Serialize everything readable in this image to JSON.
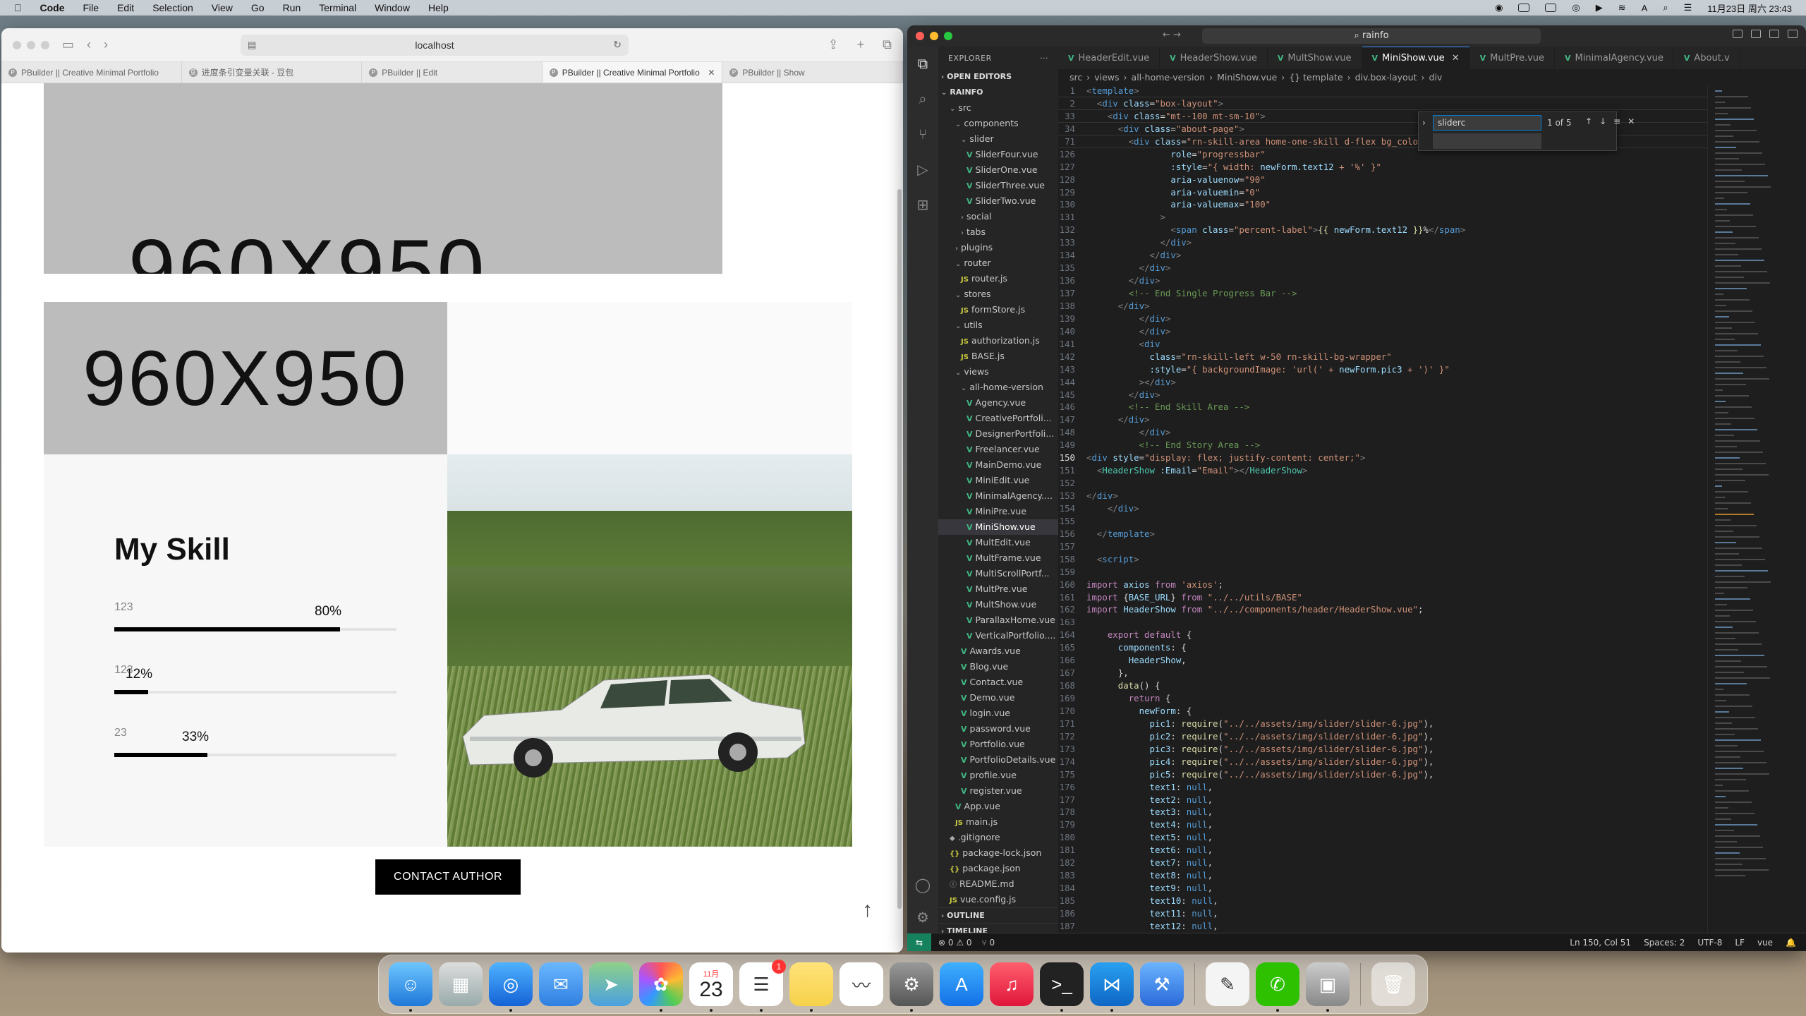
{
  "menubar": {
    "app": "Code",
    "items": [
      "File",
      "Edit",
      "Selection",
      "View",
      "Go",
      "Run",
      "Terminal",
      "Window",
      "Help"
    ],
    "clock": "11月23日 周六 23:43",
    "input_indicator": "A"
  },
  "browser": {
    "url": "localhost",
    "tabs": [
      {
        "label": "PBuilder || Creative Minimal Portfolio",
        "active": false
      },
      {
        "label": "进度条引变量关联 - 豆包",
        "active": false
      },
      {
        "label": "PBuilder || Edit",
        "active": false
      },
      {
        "label": "PBuilder || Creative Minimal Portfolio",
        "active": true
      },
      {
        "label": "PBuilder || Show",
        "active": false
      }
    ],
    "page": {
      "top_placeholder": "960X950",
      "placeholder": "960X950",
      "skill_title": "My Skill",
      "skills": [
        {
          "name": "123",
          "percent_label": "80%",
          "value": 80
        },
        {
          "name": "123",
          "percent_label": "12%",
          "value": 12
        },
        {
          "name": "23",
          "percent_label": "33%",
          "value": 33
        }
      ],
      "contact_button": "CONTACT AUTHOR",
      "scroll_top_icon": "↑"
    }
  },
  "vscode": {
    "search": "rainfo",
    "explorer": {
      "title": "EXPLORER",
      "open_editors": "OPEN EDITORS",
      "root": "RAINFO",
      "tree": [
        {
          "label": "src",
          "type": "folder"
        },
        {
          "label": "components",
          "type": "folder"
        },
        {
          "label": "slider",
          "type": "folder"
        },
        {
          "label": "SliderFour.vue",
          "type": "vue"
        },
        {
          "label": "SliderOne.vue",
          "type": "vue"
        },
        {
          "label": "SliderThree.vue",
          "type": "vue"
        },
        {
          "label": "SliderTwo.vue",
          "type": "vue"
        },
        {
          "label": "social",
          "type": "folder-closed"
        },
        {
          "label": "tabs",
          "type": "folder-closed"
        },
        {
          "label": "plugins",
          "type": "folder-closed"
        },
        {
          "label": "router",
          "type": "folder"
        },
        {
          "label": "router.js",
          "type": "js"
        },
        {
          "label": "stores",
          "type": "folder"
        },
        {
          "label": "formStore.js",
          "type": "js"
        },
        {
          "label": "utils",
          "type": "folder"
        },
        {
          "label": "authorization.js",
          "type": "js"
        },
        {
          "label": "BASE.js",
          "type": "js"
        },
        {
          "label": "views",
          "type": "folder"
        },
        {
          "label": "all-home-version",
          "type": "folder"
        },
        {
          "label": "Agency.vue",
          "type": "vue"
        },
        {
          "label": "CreativePortfoli...",
          "type": "vue"
        },
        {
          "label": "DesignerPortfoli...",
          "type": "vue"
        },
        {
          "label": "Freelancer.vue",
          "type": "vue"
        },
        {
          "label": "MainDemo.vue",
          "type": "vue"
        },
        {
          "label": "MiniEdit.vue",
          "type": "vue"
        },
        {
          "label": "MinimalAgency....",
          "type": "vue"
        },
        {
          "label": "MiniPre.vue",
          "type": "vue"
        },
        {
          "label": "MiniShow.vue",
          "type": "vue",
          "selected": true
        },
        {
          "label": "MultEdit.vue",
          "type": "vue"
        },
        {
          "label": "MultFrame.vue",
          "type": "vue"
        },
        {
          "label": "MultiScrollPortf...",
          "type": "vue"
        },
        {
          "label": "MultPre.vue",
          "type": "vue"
        },
        {
          "label": "MultShow.vue",
          "type": "vue"
        },
        {
          "label": "ParallaxHome.vue",
          "type": "vue"
        },
        {
          "label": "VerticalPortfolio....",
          "type": "vue"
        },
        {
          "label": "Awards.vue",
          "type": "vue"
        },
        {
          "label": "Blog.vue",
          "type": "vue"
        },
        {
          "label": "Contact.vue",
          "type": "vue"
        },
        {
          "label": "Demo.vue",
          "type": "vue"
        },
        {
          "label": "login.vue",
          "type": "vue"
        },
        {
          "label": "password.vue",
          "type": "vue"
        },
        {
          "label": "Portfolio.vue",
          "type": "vue"
        },
        {
          "label": "PortfolioDetails.vue",
          "type": "vue"
        },
        {
          "label": "profile.vue",
          "type": "vue"
        },
        {
          "label": "register.vue",
          "type": "vue"
        },
        {
          "label": "App.vue",
          "type": "vue"
        },
        {
          "label": "main.js",
          "type": "js"
        },
        {
          "label": ".gitignore",
          "type": "file"
        },
        {
          "label": "package-lock.json",
          "type": "json"
        },
        {
          "label": "package.json",
          "type": "json"
        },
        {
          "label": "README.md",
          "type": "md"
        },
        {
          "label": "vue.config.js",
          "type": "js"
        }
      ],
      "outline": "OUTLINE",
      "timeline": "TIMELINE"
    },
    "tabs": [
      "HeaderEdit.vue",
      "HeaderShow.vue",
      "MultShow.vue",
      "MiniShow.vue",
      "MultPre.vue",
      "MinimalAgency.vue",
      "About.v"
    ],
    "active_tab": "MiniShow.vue",
    "breadcrumbs": [
      "src",
      "views",
      "all-home-version",
      "MiniShow.vue",
      "{} template",
      "div.box-layout",
      "div"
    ],
    "find": {
      "query": "sliderc",
      "count": "1 of 5"
    },
    "status": {
      "errors": "⊗ 0 ⚠ 0",
      "ports": "⑂ 0",
      "position": "Ln 150, Col 51",
      "spaces": "Spaces: 2",
      "encoding": "UTF-8",
      "eol": "LF",
      "language": "vue"
    }
  },
  "dock": {
    "apps": [
      "Finder",
      "Launchpad",
      "Safari",
      "Mail",
      "Maps",
      "Photos",
      "Calendar",
      "Reminders",
      "Notes",
      "Freeform",
      "System Settings",
      "App Store",
      "Music",
      "Terminal",
      "VS Code",
      "Xcode",
      "TextEdit",
      "WeChat",
      "Preview",
      "Trash"
    ],
    "calendar_month": "11月",
    "calendar_day": "23",
    "reminders_badge": "1"
  }
}
